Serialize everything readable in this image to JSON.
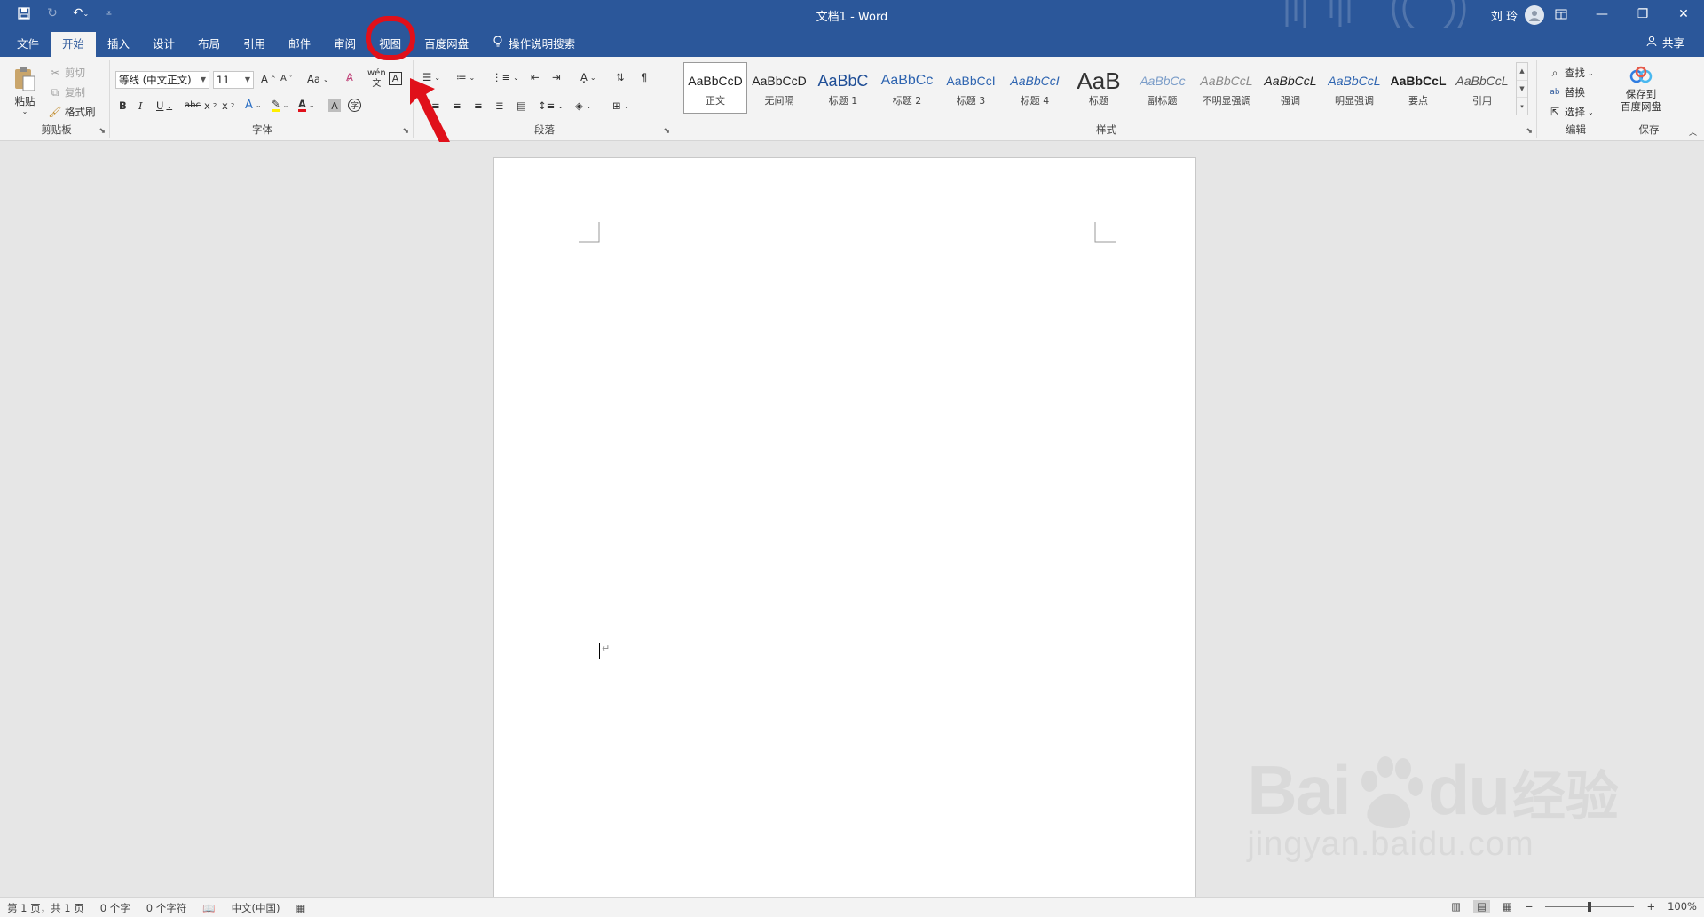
{
  "app": {
    "title": "文档1  -  Word",
    "user_name": "刘 玲",
    "share_label": "共享"
  },
  "quick_access": [
    "save-icon",
    "redo-icon",
    "undo-icon",
    "customize-icon"
  ],
  "tabs": [
    {
      "label": "文件",
      "active": false
    },
    {
      "label": "开始",
      "active": true
    },
    {
      "label": "插入",
      "active": false
    },
    {
      "label": "设计",
      "active": false
    },
    {
      "label": "布局",
      "active": false
    },
    {
      "label": "引用",
      "active": false
    },
    {
      "label": "邮件",
      "active": false
    },
    {
      "label": "审阅",
      "active": false
    },
    {
      "label": "视图",
      "active": false
    },
    {
      "label": "百度网盘",
      "active": false
    }
  ],
  "tellme": "操作说明搜索",
  "clipboard": {
    "paste": "粘贴",
    "cut": "剪切",
    "copy": "复制",
    "format_painter": "格式刷",
    "label": "剪贴板"
  },
  "font": {
    "name": "等线 (中文正文)",
    "size": "11",
    "label": "字体"
  },
  "paragraph": {
    "label": "段落"
  },
  "styles": {
    "label": "样式",
    "items": [
      {
        "sample": "AaBbCcD",
        "name": "正文"
      },
      {
        "sample": "AaBbCcD",
        "name": "无间隔"
      },
      {
        "sample": "AaBbC",
        "name": "标题 1"
      },
      {
        "sample": "AaBbCc",
        "name": "标题 2"
      },
      {
        "sample": "AaBbCcI",
        "name": "标题 3"
      },
      {
        "sample": "AaBbCcI",
        "name": "标题 4"
      },
      {
        "sample": "AaB",
        "name": "标题"
      },
      {
        "sample": "AaBbCc",
        "name": "副标题"
      },
      {
        "sample": "AaBbCcL",
        "name": "不明显强调"
      },
      {
        "sample": "AaBbCcL",
        "name": "强调"
      },
      {
        "sample": "AaBbCcL",
        "name": "明显强调"
      },
      {
        "sample": "AaBbCcL",
        "name": "要点"
      },
      {
        "sample": "AaBbCcL",
        "name": "引用"
      }
    ]
  },
  "editing": {
    "find": "查找",
    "replace": "替换",
    "select": "选择",
    "label": "编辑"
  },
  "save_group": {
    "button": "保存到\n百度网盘",
    "label": "保存"
  },
  "status": {
    "page": "第 1 页，共 1 页",
    "words": "0 个字",
    "chars": "0 个字符",
    "language": "中文(中国)",
    "zoom": "100%",
    "zoom_value": 100
  },
  "watermark": {
    "brand": "Bai",
    "brand2": "du",
    "cn": "经验",
    "url": "jingyan.baidu.com"
  },
  "colors": {
    "accent": "#2b579a",
    "highlight": "#e0101a"
  }
}
